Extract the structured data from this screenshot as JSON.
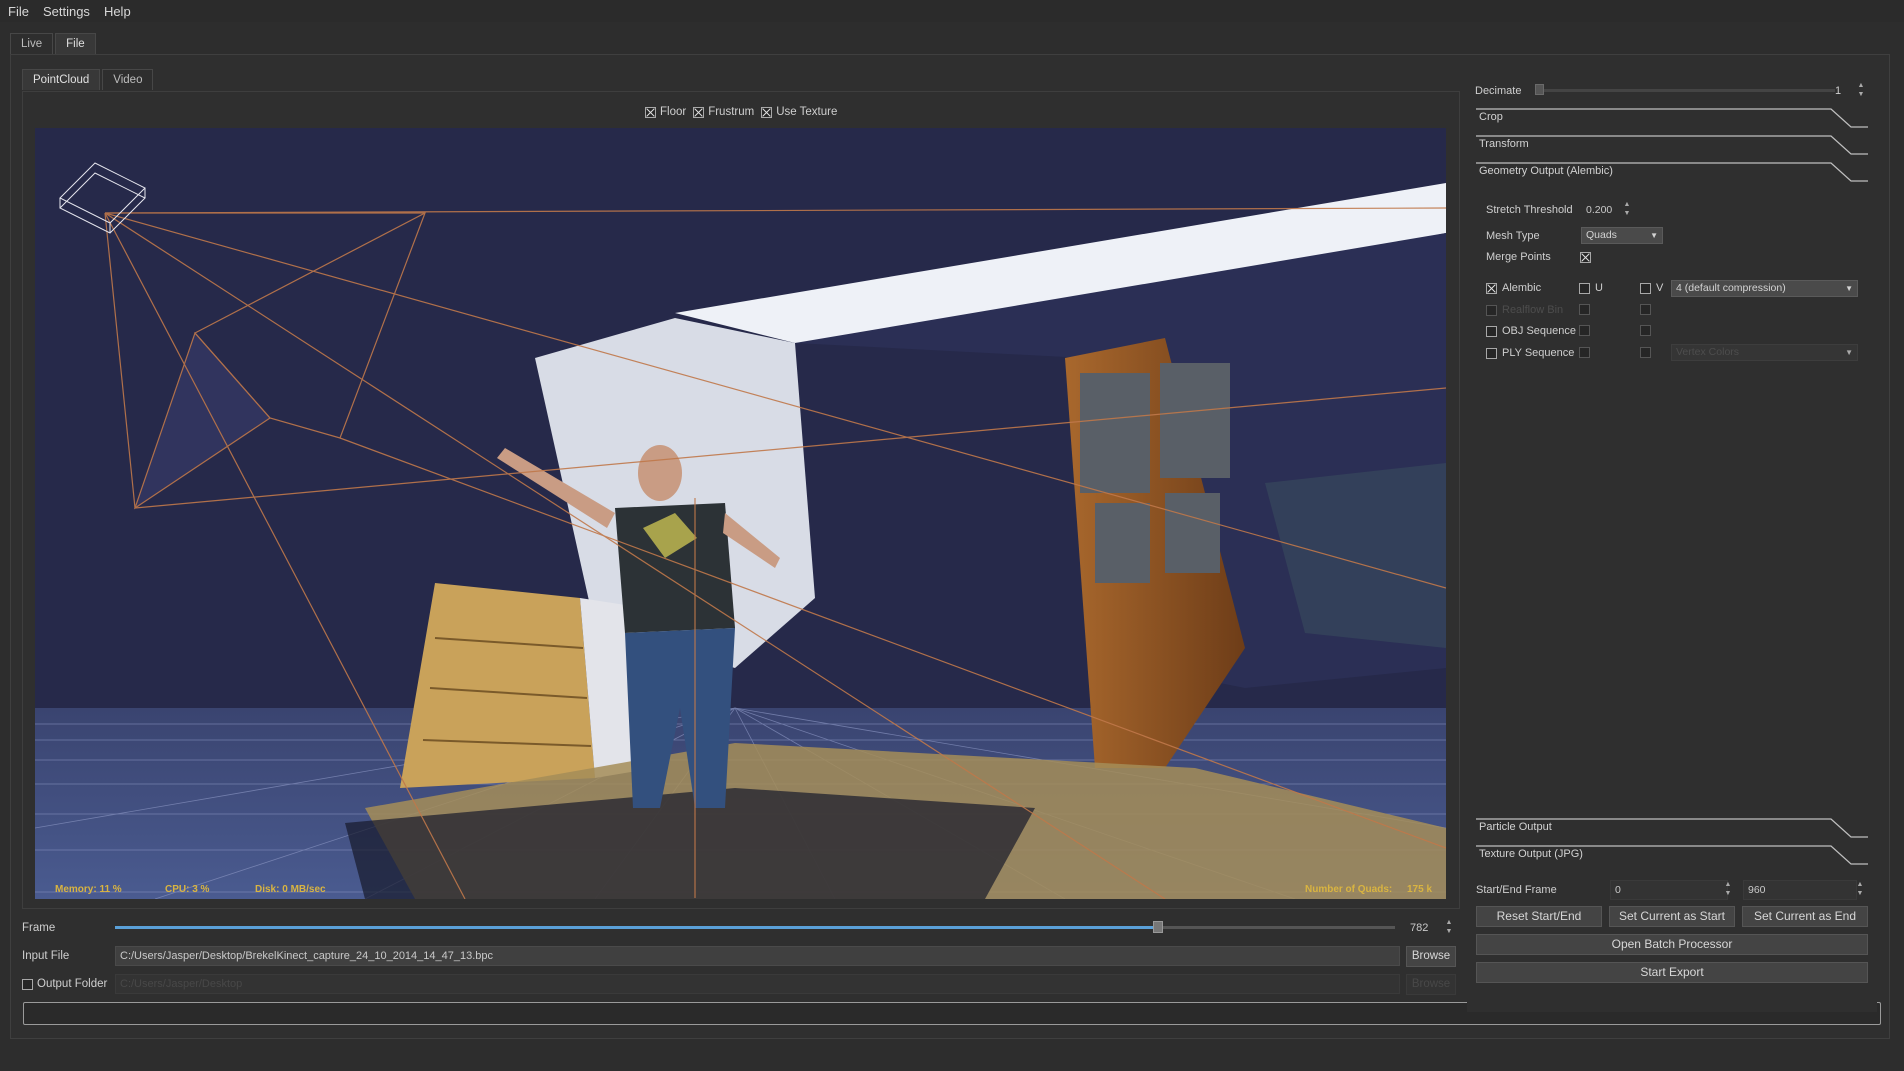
{
  "menu": {
    "items": [
      "File",
      "Settings",
      "Help"
    ]
  },
  "main_tabs": [
    {
      "label": "Live"
    },
    {
      "label": "File"
    }
  ],
  "sub_tabs": [
    {
      "label": "PointCloud"
    },
    {
      "label": "Video"
    }
  ],
  "view_options": [
    {
      "label": "Floor",
      "checked": true
    },
    {
      "label": "Frustrum",
      "checked": true
    },
    {
      "label": "Use Texture",
      "checked": true
    }
  ],
  "stats": {
    "memory": "Memory:  11 %",
    "cpu": "CPU:  3 %",
    "disk": "Disk:  0 MB/sec",
    "quads_label": "Number of Quads:",
    "quads_value": "175 k"
  },
  "frame": {
    "label": "Frame",
    "value": "782",
    "fraction": 0.815
  },
  "input_file": {
    "label": "Input File",
    "value": "C:/Users/Jasper/Desktop/BrekelKinect_capture_24_10_2014_14_47_13.bpc",
    "browse": "Browse"
  },
  "output_folder": {
    "label": "Output Folder",
    "value": "C:/Users/Jasper/Desktop",
    "browse": "Browse",
    "checked": false
  },
  "right_panel": {
    "decimate": {
      "label": "Decimate",
      "value": "1"
    },
    "sections": {
      "crop": "Crop",
      "transform": "Transform",
      "geometry": "Geometry Output (Alembic)",
      "particle": "Particle Output",
      "texture": "Texture Output (JPG)"
    },
    "stretch_threshold": {
      "label": "Stretch Threshold",
      "value": "0.200"
    },
    "mesh_type": {
      "label": "Mesh Type",
      "value": "Quads"
    },
    "merge_points": {
      "label": "Merge Points",
      "checked": true
    },
    "formats": [
      {
        "label": "Alembic",
        "checked": true,
        "enabled": true
      },
      {
        "label": "Realflow Bin",
        "checked": false,
        "enabled": false
      },
      {
        "label": "OBJ Sequence",
        "checked": false,
        "enabled": true
      },
      {
        "label": "PLY Sequence",
        "checked": false,
        "enabled": true
      }
    ],
    "u_label": "U",
    "v_label": "V",
    "compression": "4 (default compression)",
    "ply_option": "Vertex Colors",
    "start_end": {
      "label": "Start/End Frame",
      "start": "0",
      "end": "960"
    },
    "buttons": {
      "reset": "Reset Start/End",
      "set_start": "Set Current as Start",
      "set_end": "Set Current as End",
      "batch": "Open Batch Processor",
      "export": "Start Export"
    }
  }
}
